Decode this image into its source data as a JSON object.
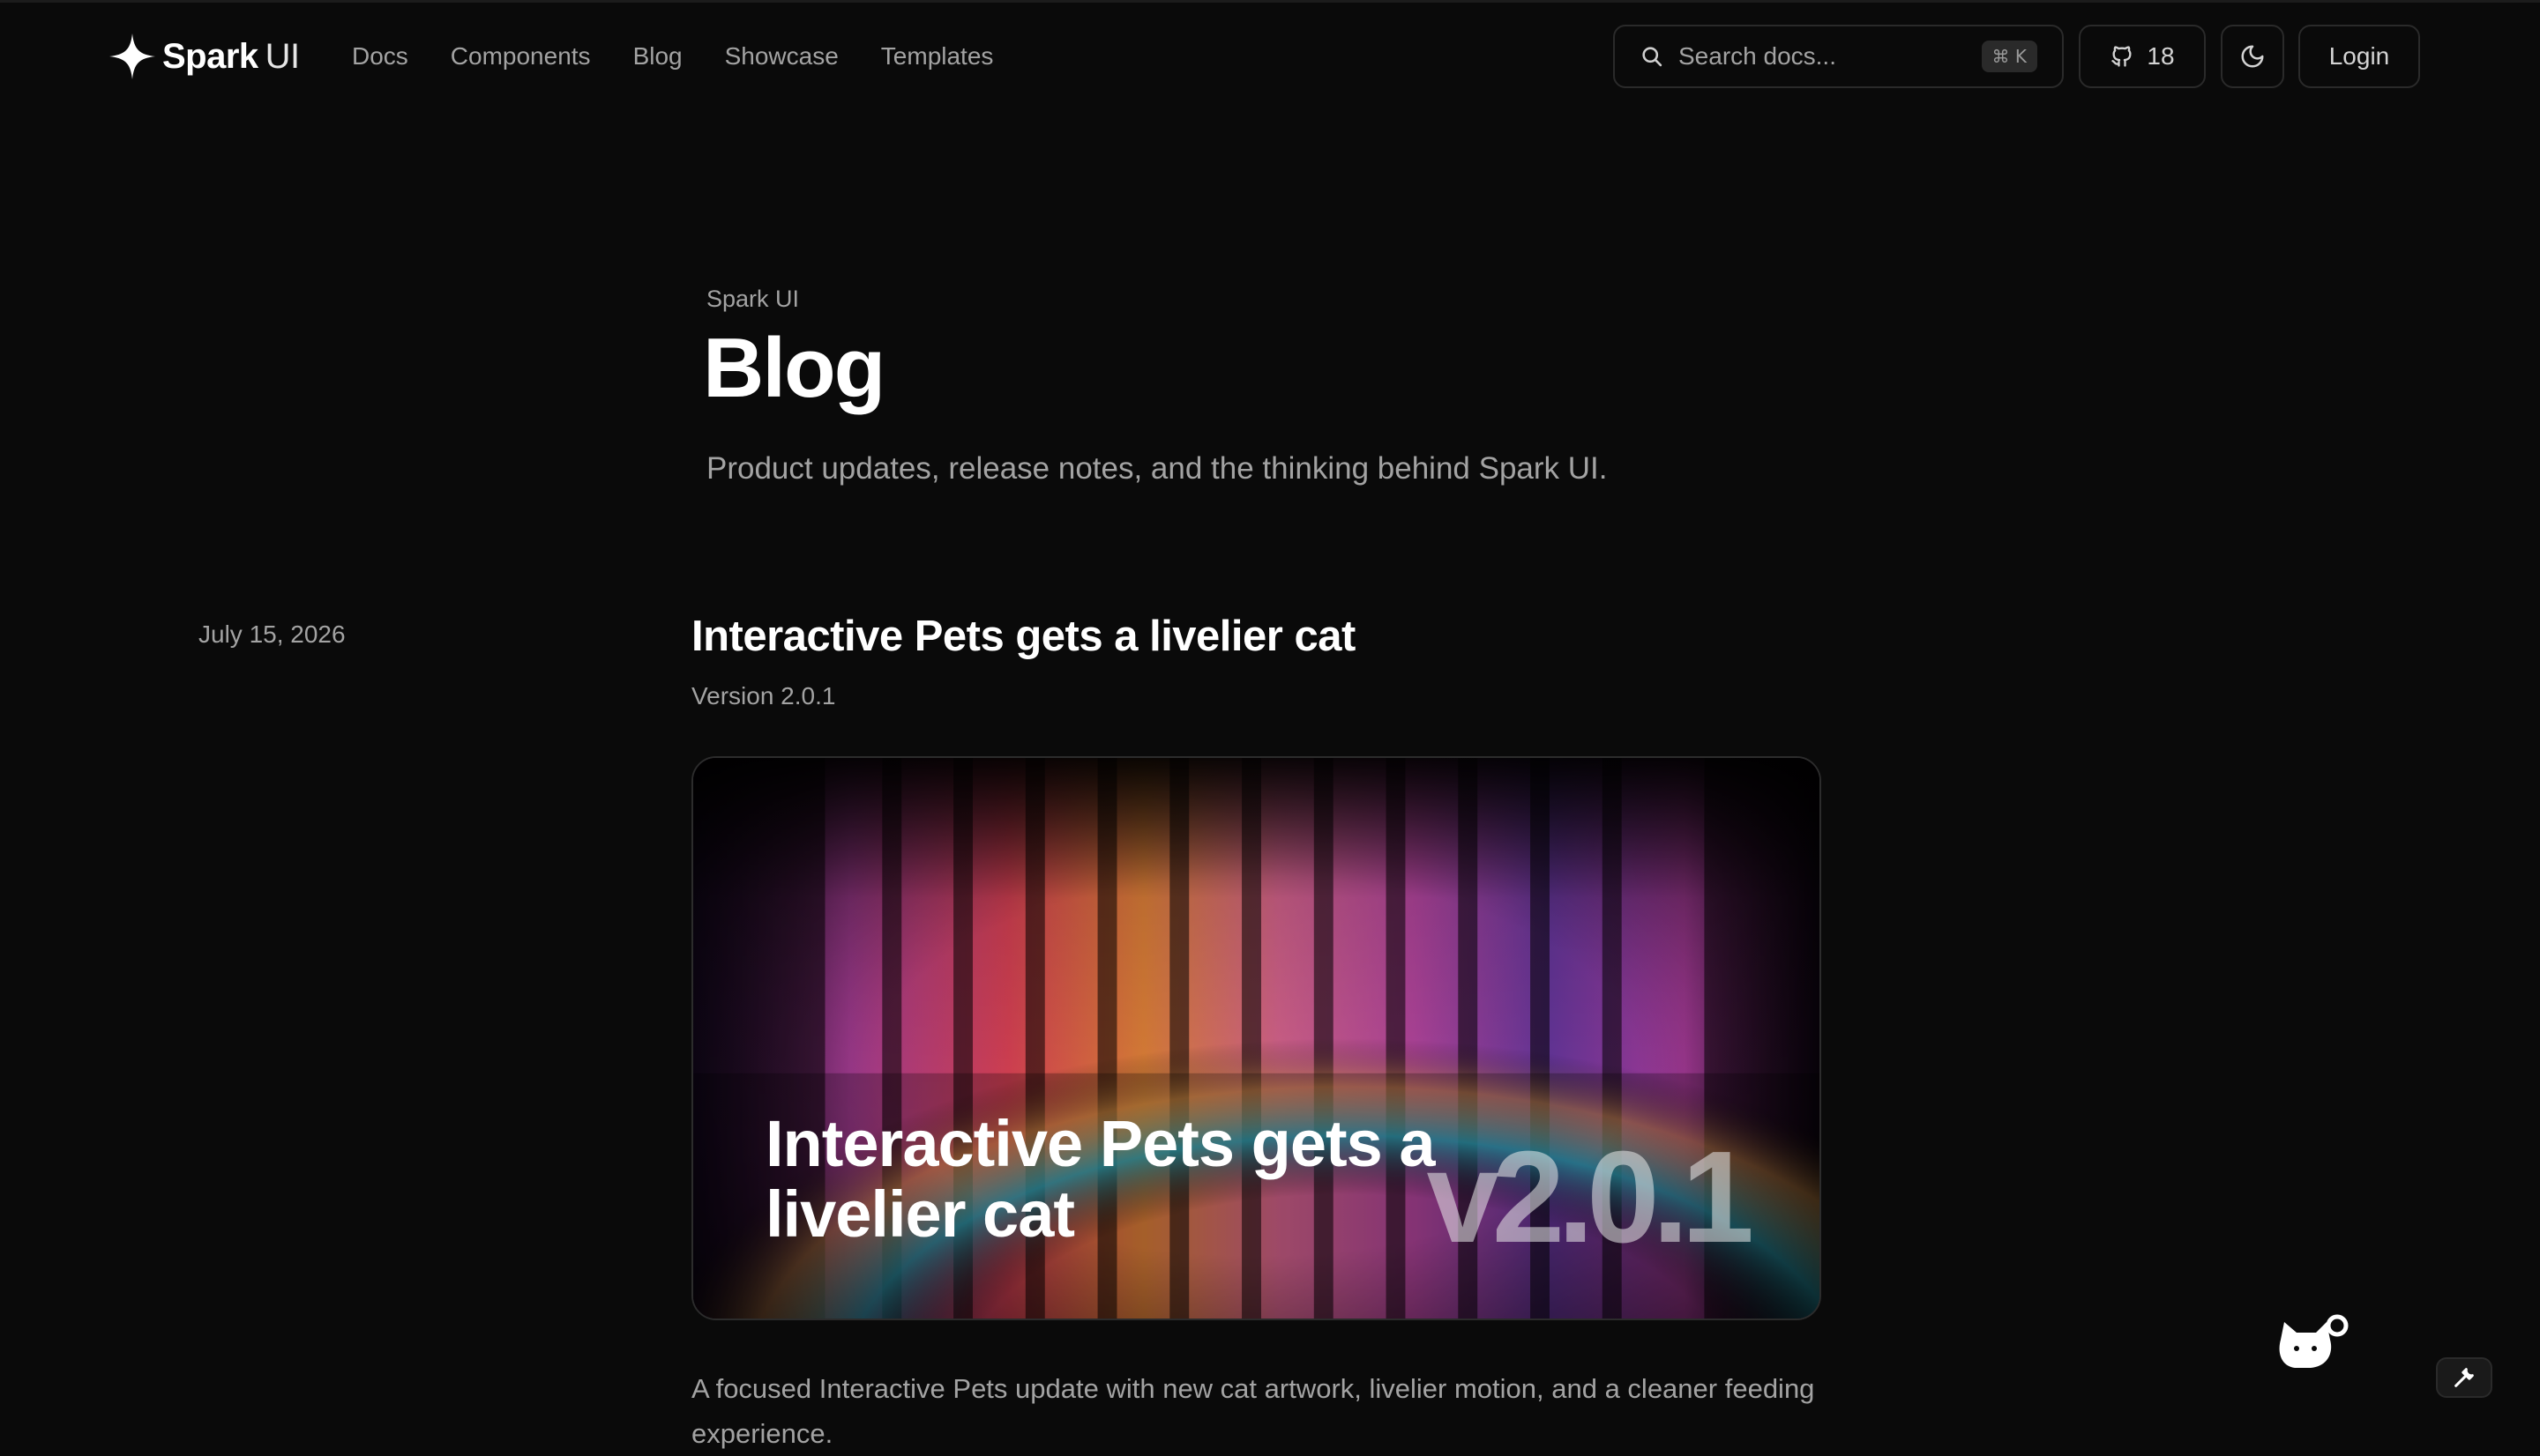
{
  "brand": {
    "name": "Spark",
    "suffix": "UI",
    "logo_icon": "sparkle-icon"
  },
  "nav": {
    "items": [
      {
        "label": "Docs"
      },
      {
        "label": "Components"
      },
      {
        "label": "Blog"
      },
      {
        "label": "Showcase"
      },
      {
        "label": "Templates"
      }
    ]
  },
  "search": {
    "placeholder": "Search docs...",
    "shortcut": "⌘ K",
    "icon": "search-icon"
  },
  "github": {
    "stars": "18",
    "icon": "github-icon"
  },
  "theme_toggle": {
    "icon": "moon-icon"
  },
  "login": {
    "label": "Login"
  },
  "hero": {
    "eyebrow": "Spark UI",
    "title": "Blog",
    "subtitle": "Product updates, release notes, and the thinking behind Spark UI."
  },
  "post": {
    "date": "July 15, 2026",
    "title": "Interactive Pets gets a livelier cat",
    "version": "Version 2.0.1",
    "cover": {
      "title": "Interactive Pets gets a livelier cat",
      "version_badge": "v2.0.1"
    },
    "excerpt": "A focused Interactive Pets update with new cat artwork, livelier motion, and a cleaner feeding experience."
  },
  "floating": {
    "pet_icon": "cat-icon",
    "tool_icon": "wrench-icon"
  },
  "colors": {
    "background": "#0a0a0a",
    "text_primary": "#ffffff",
    "text_muted": "#a3a3a3",
    "border": "#2a2a2a"
  }
}
